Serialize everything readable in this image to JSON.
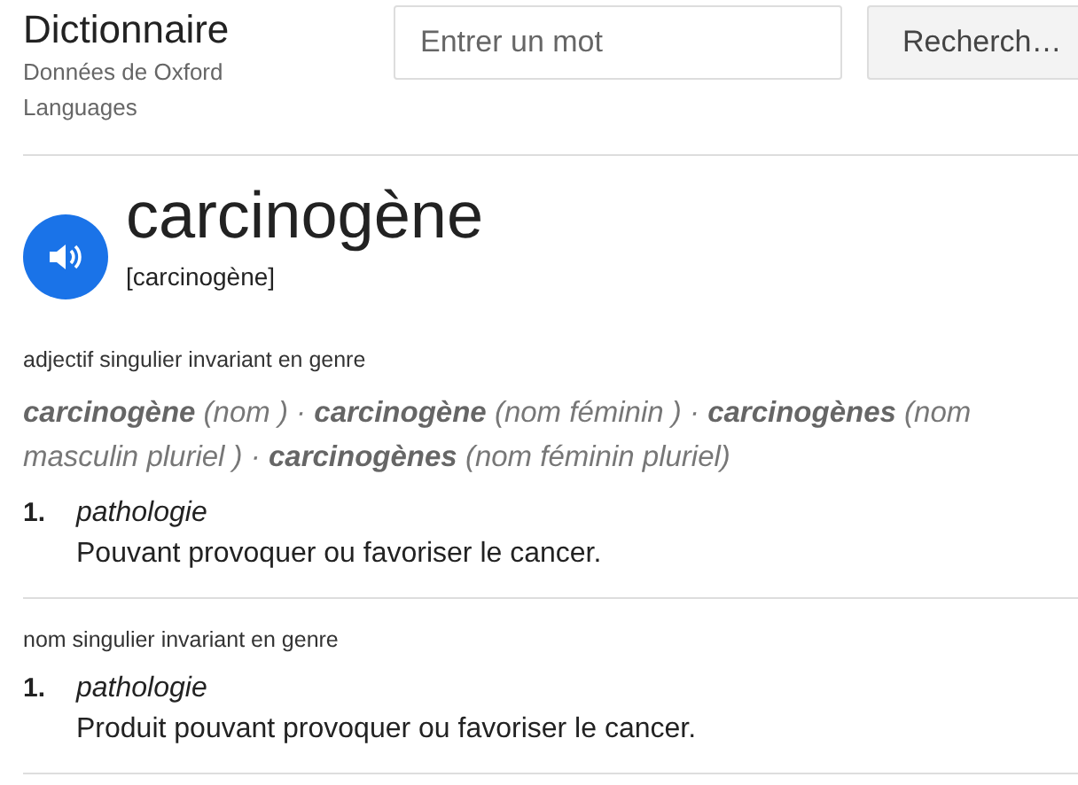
{
  "header": {
    "title": "Dictionnaire",
    "source": "Données de Oxford Languages",
    "search": {
      "placeholder": "Entrer un mot"
    },
    "button": "Recherch…"
  },
  "entry": {
    "word": "carcinogène",
    "phonetic": "[carcinogène]"
  },
  "sections": [
    {
      "grammar": "adjectif singulier invariant en genre",
      "forms": "**carcinogène** (nom ) · **carcinogène** (nom féminin ) · **carcinogènes** (nom masculin pluriel ) · **carcinogènes** (nom féminin pluriel)",
      "senses": [
        {
          "number": "1.",
          "domain": "pathologie",
          "definition": "Pouvant provoquer ou favoriser le cancer."
        }
      ]
    },
    {
      "grammar": "nom singulier invariant en genre",
      "senses": [
        {
          "number": "1.",
          "domain": "pathologie",
          "definition": "Produit pouvant provoquer ou favoriser le cancer."
        }
      ]
    }
  ]
}
